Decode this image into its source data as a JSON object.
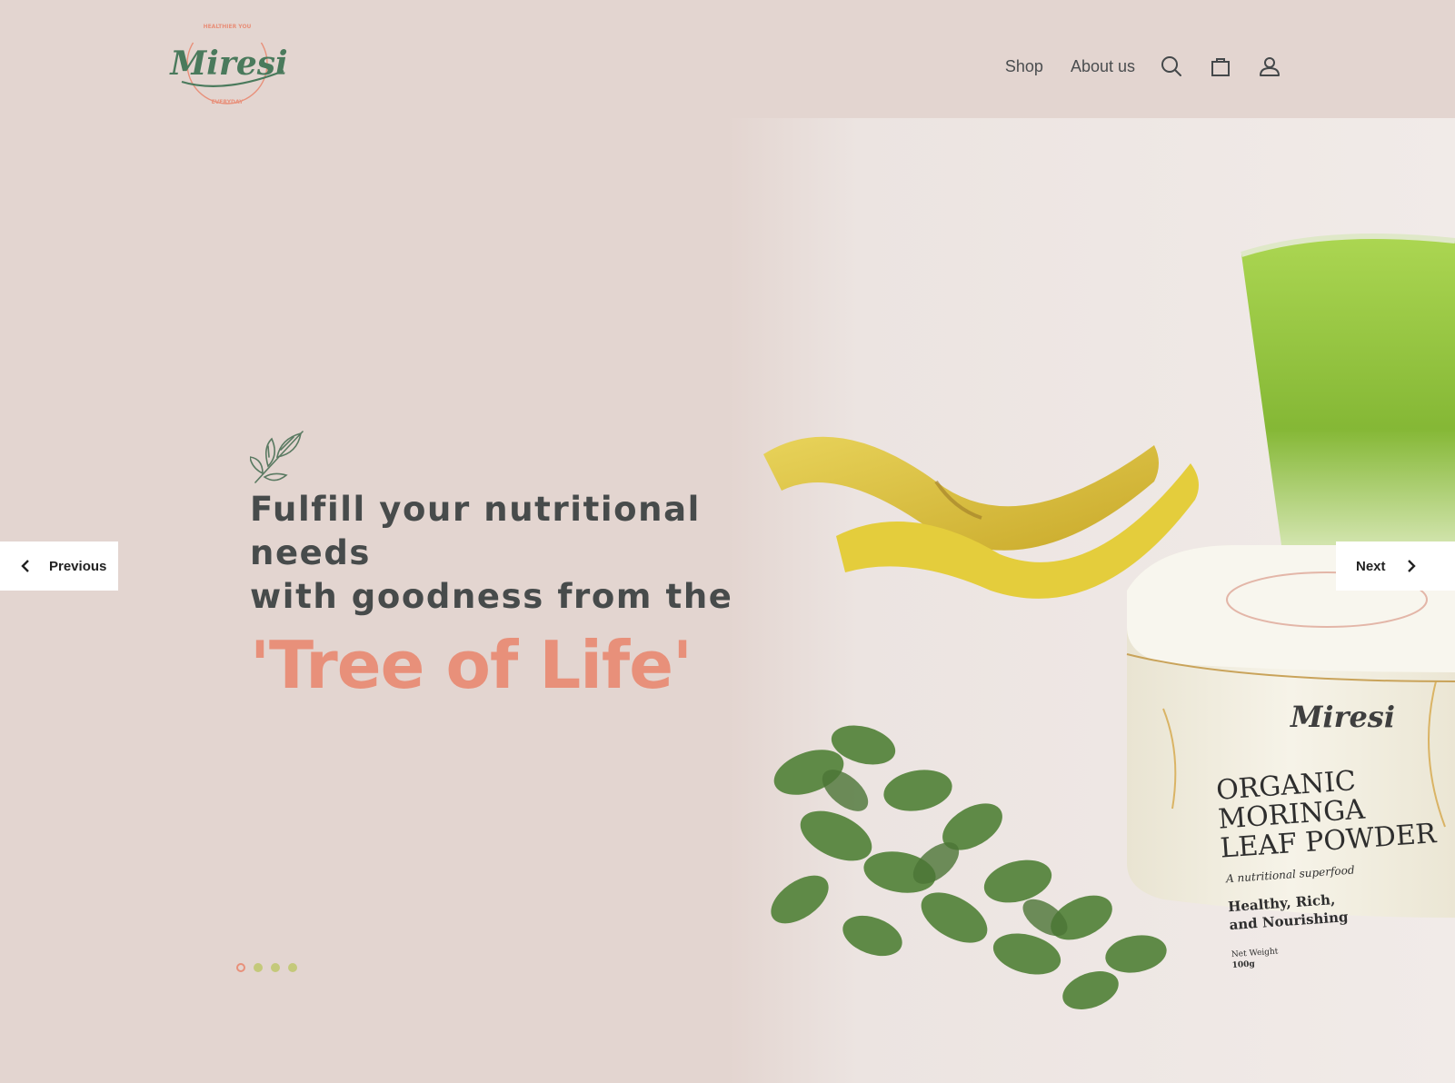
{
  "brand": {
    "name": "Miresi",
    "tagline_top": "HEALTHIER YOU",
    "tagline_bottom": "EVERYDAY"
  },
  "nav": {
    "links": [
      {
        "label": "Shop"
      },
      {
        "label": "About us"
      }
    ],
    "icons": [
      "search-icon",
      "cart-icon",
      "account-icon"
    ]
  },
  "hero": {
    "headline_line1": "Fulfill your nutritional needs",
    "headline_line2": "with goodness from the",
    "highlight": "'Tree of Life'",
    "product_label": {
      "brand": "Miresi",
      "line1": "ORGANIC",
      "line2": "MORINGA",
      "line3": "LEAF POWDER",
      "subtitle": "A nutritional superfood",
      "benefit1": "Healthy, Rich,",
      "benefit2": "and Nourishing",
      "weight_label": "Net Weight",
      "weight_value": "100g"
    }
  },
  "carousel": {
    "prev_label": "Previous",
    "next_label": "Next",
    "slide_count": 4,
    "active_slide": 1
  },
  "colors": {
    "background": "#e3d5d0",
    "accent": "#e8907a",
    "brand_green": "#4a7a5c",
    "text": "#474b4b",
    "dot_inactive": "#c4c97a"
  }
}
